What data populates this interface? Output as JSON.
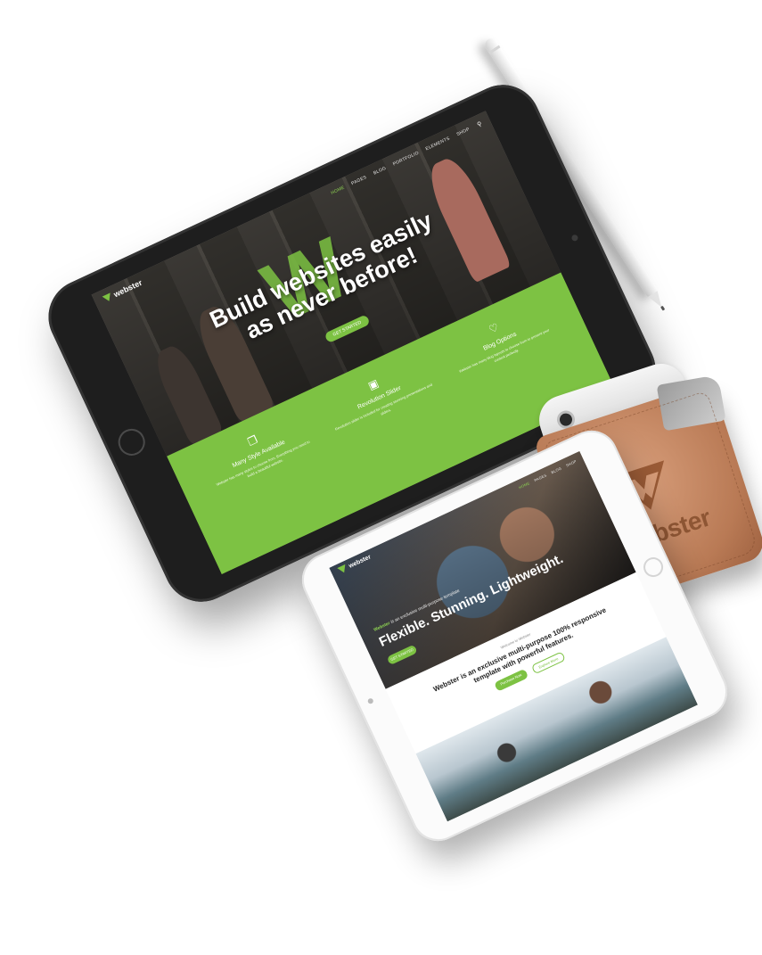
{
  "colors": {
    "brand_green": "#7dc243",
    "tablet_dark": "#1e1e1e",
    "tablet_light": "#fbfbfb",
    "leather": "#c8875f"
  },
  "large_tablet": {
    "logo": "webster",
    "nav_items": [
      "HOME",
      "PAGES",
      "BLOG",
      "PORTFOLIO",
      "ELEMENTS",
      "SHOP"
    ],
    "hero_letter": "W",
    "hero_title_line1": "Build websites easily",
    "hero_title_line2": "as never before!",
    "hero_button": "GET STARTED",
    "features": [
      {
        "icon": "copy-icon",
        "title": "Many Style Available",
        "desc": "Webster has many styles to choose from. Everything you need to build a beautiful website."
      },
      {
        "icon": "image-icon",
        "title": "Revolution Slider",
        "desc": "Revolution slider is included for creating stunning presentations and sliders."
      },
      {
        "icon": "heart-icon",
        "title": "Blog Options",
        "desc": "Webster has many blog layouts to choose from to present your content perfectly."
      }
    ]
  },
  "small_tablet": {
    "logo": "webster",
    "nav_items": [
      "HOME",
      "PAGES",
      "BLOG",
      "SHOP"
    ],
    "kicker_prefix": "Webster",
    "kicker": "is an exclusive multi-purpose template",
    "title": "Flexible. Stunning. Lightweight.",
    "hero_button": "GET STARTED",
    "subtitle": "Welcome to Webster",
    "heading": "Webster is an exclusive multi-purpose 100% responsive template with powerful features.",
    "btn_primary": "Purchase Now",
    "btn_secondary": "Explore More"
  },
  "sleeve": {
    "brand": "webster"
  }
}
